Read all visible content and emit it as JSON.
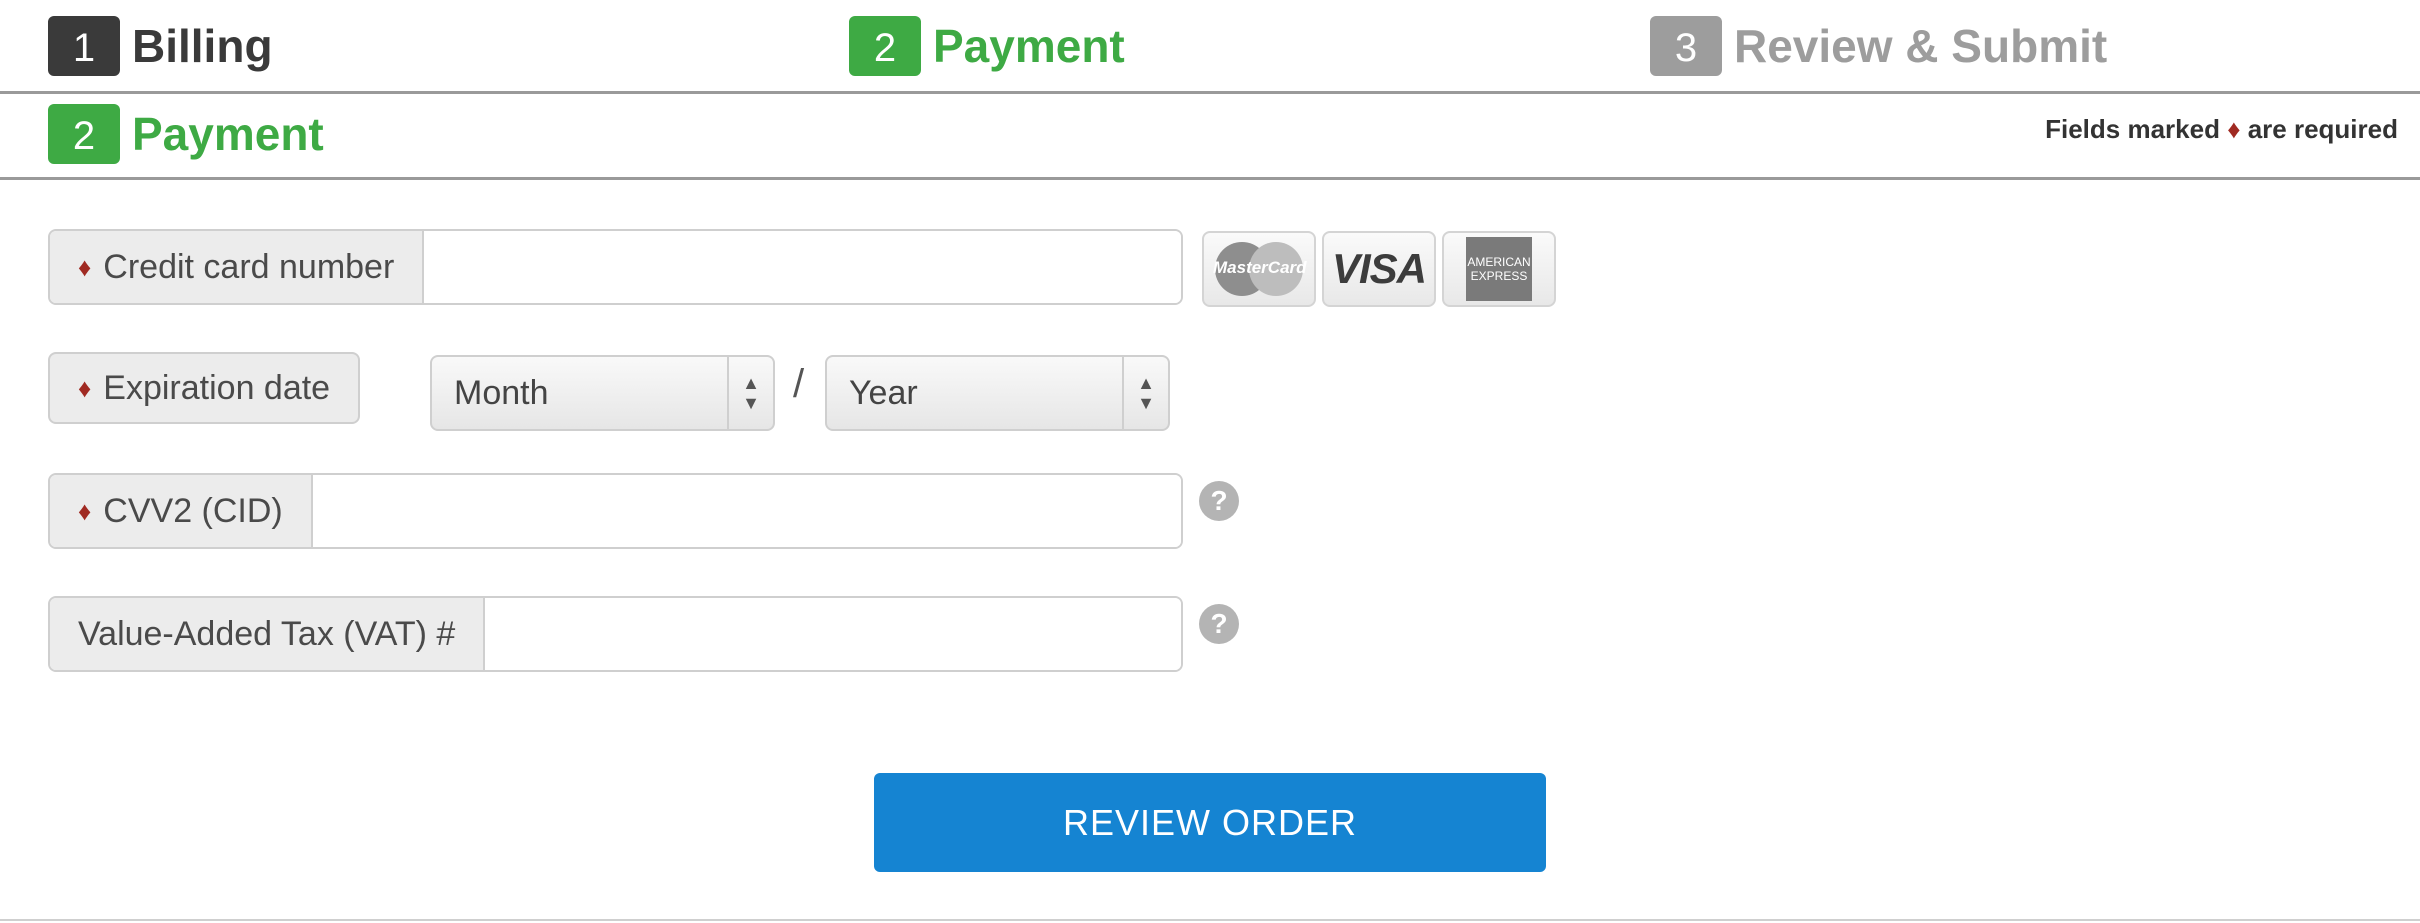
{
  "steps": [
    {
      "num": "1",
      "label": "Billing"
    },
    {
      "num": "2",
      "label": "Payment"
    },
    {
      "num": "3",
      "label": "Review & Submit"
    }
  ],
  "section": {
    "num": "2",
    "title": "Payment"
  },
  "required_note": {
    "prefix": "Fields marked",
    "marker": "♦",
    "suffix": "are required"
  },
  "fields": {
    "cc": {
      "label": "Credit card number",
      "value": ""
    },
    "expiry": {
      "label": "Expiration date",
      "month": "Month",
      "year": "Year",
      "separator": "/"
    },
    "cvv": {
      "label": "CVV2 (CID)",
      "value": ""
    },
    "vat": {
      "label": "Value-Added Tax (VAT) #",
      "value": ""
    }
  },
  "cards": {
    "mastercard": "MasterCard",
    "visa": "VISA",
    "amex_line1": "AMERICAN",
    "amex_line2": "EXPRESS"
  },
  "help_glyph": "?",
  "button": {
    "label": "REVIEW ORDER"
  },
  "colors": {
    "active": "#3eaa44",
    "done": "#3a3a3a",
    "pending": "#9d9d9d",
    "button": "#1584d2",
    "required": "#a02a22"
  }
}
